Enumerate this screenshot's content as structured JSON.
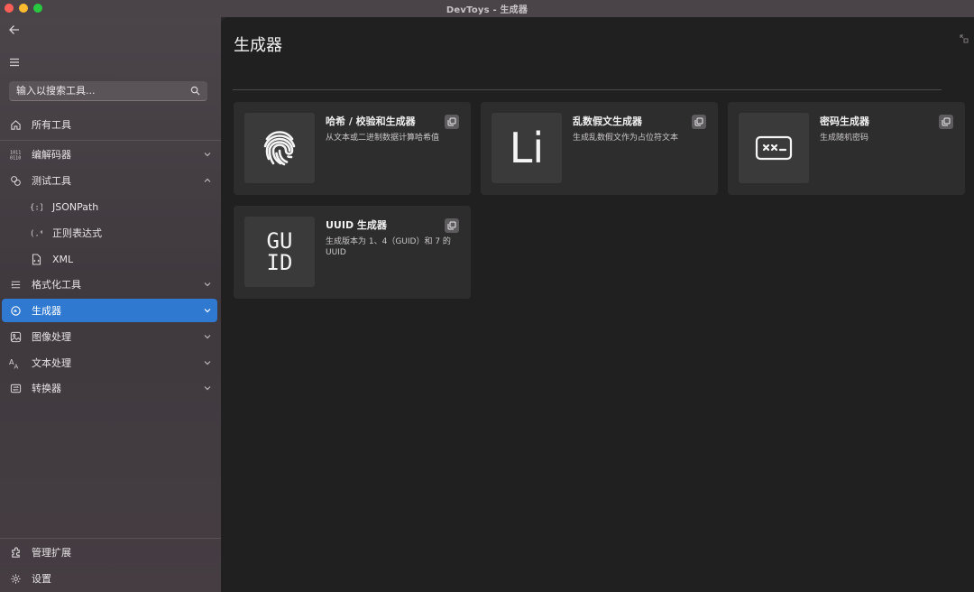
{
  "window": {
    "title": "DevToys - 生成器"
  },
  "sidebar": {
    "search_placeholder": "输入以搜索工具...",
    "items": [
      {
        "label": "所有工具",
        "icon": "home-icon"
      },
      {
        "label": "编解码器",
        "icon": "binary-icon"
      },
      {
        "label": "测试工具",
        "icon": "test-icon"
      },
      {
        "label": "JSONPath",
        "icon": "jsonpath-icon"
      },
      {
        "label": "正则表达式",
        "icon": "regex-icon"
      },
      {
        "label": "XML",
        "icon": "xml-file-icon"
      },
      {
        "label": "格式化工具",
        "icon": "format-icon"
      },
      {
        "label": "生成器",
        "icon": "generator-icon"
      },
      {
        "label": "图像处理",
        "icon": "image-icon"
      },
      {
        "label": "文本处理",
        "icon": "text-icon"
      },
      {
        "label": "转换器",
        "icon": "converter-icon"
      }
    ],
    "footer": [
      {
        "label": "管理扩展",
        "icon": "extension-icon"
      },
      {
        "label": "设置",
        "icon": "gear-icon"
      }
    ]
  },
  "main": {
    "title": "生成器",
    "cards": [
      {
        "title": "哈希 / 校验和生成器",
        "desc": "从文本或二进制数据计算哈希值",
        "icon": "fingerprint-icon"
      },
      {
        "title": "乱数假文生成器",
        "desc": "生成乱数假文作为占位符文本",
        "icon_text": "Li"
      },
      {
        "title": "密码生成器",
        "desc": "生成随机密码",
        "icon": "password-icon"
      },
      {
        "title": "UUID 生成器",
        "desc": "生成版本为 1、4（GUID）和 7 的 UUID",
        "icon_text_1": "GU",
        "icon_text_2": "ID"
      }
    ]
  },
  "colors": {
    "accent": "#2f79d0",
    "sidebar_bg": "#453e43",
    "main_bg": "#212021",
    "card_bg": "#2e2d2e"
  }
}
